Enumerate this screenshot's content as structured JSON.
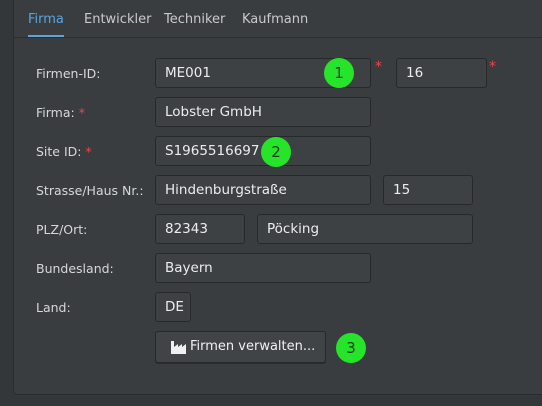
{
  "tabs": [
    "Firma",
    "Entwickler",
    "Techniker",
    "Kaufmann"
  ],
  "form": {
    "firmen_id_label": "Firmen-ID:",
    "firmen_id_value": "ME001",
    "firmen_id_suffix": "16",
    "firma_label": "Firma:",
    "firma_value": "Lobster GmbH",
    "site_id_label": "Site ID:",
    "site_id_value": "S1965516697",
    "strasse_label": "Strasse/Haus Nr.:",
    "strasse_value": "Hindenburgstraße",
    "hausnr_value": "15",
    "plz_ort_label": "PLZ/Ort:",
    "plz_value": "82343",
    "ort_value": "Pöcking",
    "bundesland_label": "Bundesland:",
    "bundesland_value": "Bayern",
    "land_label": "Land:",
    "land_value": "DE",
    "required_marker": "*"
  },
  "buttons": {
    "manage_label": "Firmen verwalten..."
  },
  "badges": [
    "1",
    "2",
    "3"
  ],
  "colors": {
    "accent": "#5aa4de",
    "required": "#e5484d",
    "badge": "#26e42a"
  }
}
